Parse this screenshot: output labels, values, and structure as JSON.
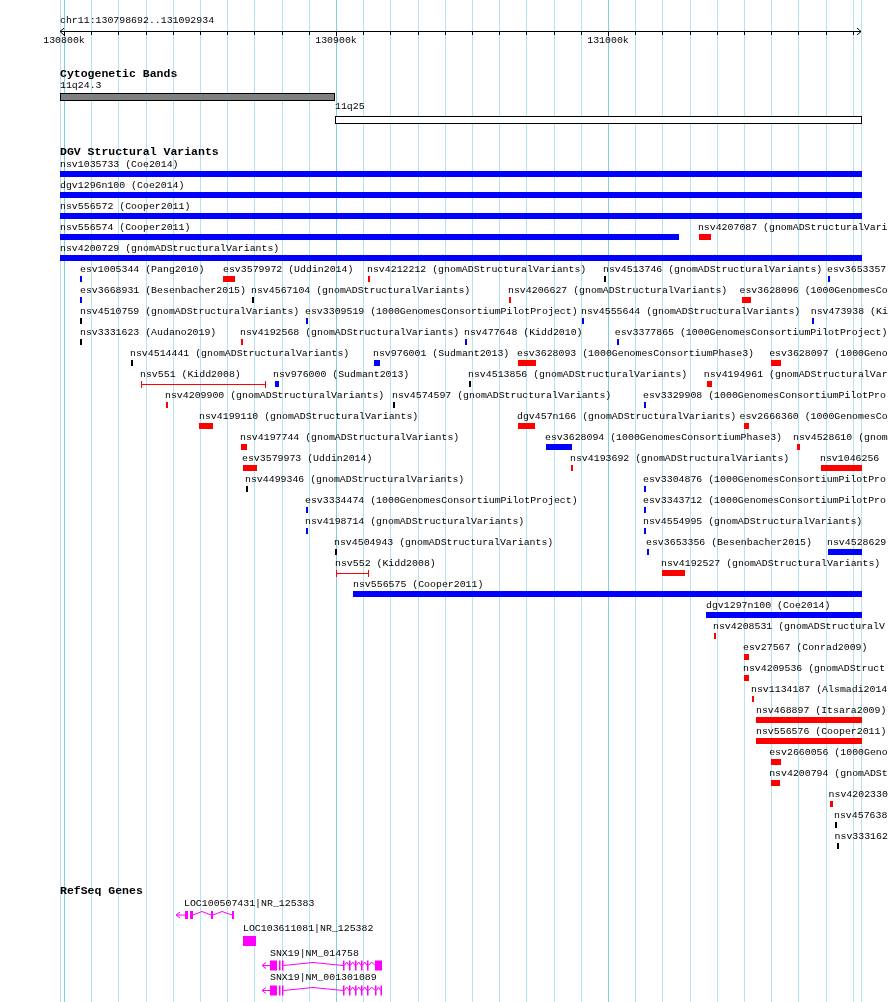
{
  "ruler": {
    "location": "chr11:130798692..131092934",
    "ticks": [
      "130800k",
      "130900k",
      "131000k"
    ]
  },
  "tracks": [
    {
      "kind": "cytobands",
      "title": "Cytogenetic Bands",
      "features": [
        {
          "label": "11q24.3",
          "color": "#808080"
        },
        {
          "label": "11q25",
          "color": "#ffffff"
        }
      ]
    },
    {
      "kind": "variants",
      "title": "DGV Structural Variants",
      "features": [
        {
          "label": "nsv1035733 (Coe2014)",
          "kind": "bar",
          "color": "#0000ff"
        },
        {
          "label": "dgv1296n100 (Coe2014)",
          "kind": "bar",
          "color": "#0000ff"
        },
        {
          "label": "nsv556572 (Cooper2011)",
          "kind": "bar",
          "color": "#0000ff"
        },
        {
          "label": "nsv556574 (Cooper2011)",
          "kind": "bar",
          "color": "#0000ff"
        },
        {
          "label": "nsv4207087 (gnomADStructuralVari",
          "kind": "bar",
          "color": "#ff0000"
        },
        {
          "label": "nsv4200729 (gnomADStructuralVariants)",
          "kind": "bar",
          "color": "#0000ff"
        },
        {
          "label": "esv1005344 (Pang2010)",
          "kind": "bar",
          "color": "#0000ff"
        },
        {
          "label": "esv3579972 (Uddin2014)",
          "kind": "bar",
          "color": "#ff0000"
        },
        {
          "label": "nsv4212212 (gnomADStructuralVariants)",
          "kind": "bar",
          "color": "#ff0000"
        },
        {
          "label": "nsv4513746 (gnomADStructuralVariants)",
          "kind": "bar",
          "color": "#000000"
        },
        {
          "label": "esv3653357",
          "kind": "bar",
          "color": "#0000ff"
        },
        {
          "label": "esv3668931 (Besenbacher2015)",
          "kind": "bar",
          "color": "#0000ff"
        },
        {
          "label": "nsv4567104 (gnomADStructuralVariants)",
          "kind": "bar",
          "color": "#000000"
        },
        {
          "label": "nsv4206627 (gnomADStructuralVariants)",
          "kind": "bar",
          "color": "#ff0000"
        },
        {
          "label": "esv3628096 (1000GenomesCo",
          "kind": "bar",
          "color": "#ff0000"
        },
        {
          "label": "nsv4510759 (gnomADStructuralVariants)",
          "kind": "bar",
          "color": "#000000"
        },
        {
          "label": "esv3309519 (1000GenomesConsortiumPilotProject)",
          "kind": "bar",
          "color": "#0000ff"
        },
        {
          "label": "nsv4555644 (gnomADStructuralVariants)",
          "kind": "bar",
          "color": "#0000ff"
        },
        {
          "label": "nsv473938 (Ki",
          "kind": "bar",
          "color": "#0000ff"
        },
        {
          "label": "nsv3331623 (Audano2019)",
          "kind": "bar",
          "color": "#000000"
        },
        {
          "label": "nsv4192568 (gnomADStructuralVariants)",
          "kind": "bar",
          "color": "#ff0000"
        },
        {
          "label": "nsv477648 (Kidd2010)",
          "kind": "bar",
          "color": "#0000ff"
        },
        {
          "label": "esv3377865 (1000GenomesConsortiumPilotProject)",
          "kind": "bar",
          "color": "#0000ff"
        },
        {
          "label": "nsv4514441 (gnomADStructuralVariants)",
          "kind": "bar",
          "color": "#000000"
        },
        {
          "label": "nsv976001 (Sudmant2013)",
          "kind": "bar",
          "color": "#0000ff"
        },
        {
          "label": "esv3628093 (1000GenomesConsortiumPhase3)",
          "kind": "bar",
          "color": "#ff0000"
        },
        {
          "label": "esv3628097 (1000Geno",
          "kind": "bar",
          "color": "#ff0000"
        },
        {
          "label": "nsv551 (Kidd2008)",
          "kind": "span",
          "color": "#ff0000"
        },
        {
          "label": "nsv976000 (Sudmant2013)",
          "kind": "bar",
          "color": "#0000ff"
        },
        {
          "label": "nsv4513856 (gnomADStructuralVariants)",
          "kind": "bar",
          "color": "#000000"
        },
        {
          "label": "nsv4194961 (gnomADStructuralVar",
          "kind": "bar",
          "color": "#ff0000"
        },
        {
          "label": "nsv4209900 (gnomADStructuralVariants)",
          "kind": "bar",
          "color": "#ff0000"
        },
        {
          "label": "nsv4574597 (gnomADStructuralVariants)",
          "kind": "bar",
          "color": "#000000"
        },
        {
          "label": "esv3329908 (1000GenomesConsortiumPilotPro",
          "kind": "bar",
          "color": "#0000ff"
        },
        {
          "label": "nsv4199110 (gnomADStructuralVariants)",
          "kind": "bar",
          "color": "#ff0000"
        },
        {
          "label": "dgv457n166 (gnomADStructuralVariants)",
          "kind": "bar",
          "color": "#ff0000"
        },
        {
          "label": "esv2666360 (1000GenomesCo",
          "kind": "bar",
          "color": "#ff0000"
        },
        {
          "label": "nsv4197744 (gnomADStructuralVariants)",
          "kind": "bar",
          "color": "#ff0000"
        },
        {
          "label": "esv3628094 (1000GenomesConsortiumPhase3)",
          "kind": "bar",
          "color": "#0000ff"
        },
        {
          "label": "nsv4528610 (gnom",
          "kind": "bar",
          "color": "#ff0000"
        },
        {
          "label": "esv3579973 (Uddin2014)",
          "kind": "bar",
          "color": "#ff0000"
        },
        {
          "label": "nsv4193692 (gnomADStructuralVariants)",
          "kind": "bar",
          "color": "#ff0000"
        },
        {
          "label": "nsv1046256",
          "kind": "bar",
          "color": "#ff0000"
        },
        {
          "label": "nsv4499346 (gnomADStructuralVariants)",
          "kind": "bar",
          "color": "#000000"
        },
        {
          "label": "esv3304876 (1000GenomesConsortiumPilotPro",
          "kind": "bar",
          "color": "#0000ff"
        },
        {
          "label": "esv3334474 (1000GenomesConsortiumPilotProject)",
          "kind": "bar",
          "color": "#0000ff"
        },
        {
          "label": "esv3343712 (1000GenomesConsortiumPilotPro",
          "kind": "bar",
          "color": "#0000ff"
        },
        {
          "label": "nsv4198714 (gnomADStructuralVariants)",
          "kind": "bar",
          "color": "#0000ff"
        },
        {
          "label": "nsv4554995 (gnomADStructuralVariants)",
          "kind": "bar",
          "color": "#0000ff"
        },
        {
          "label": "nsv4504943 (gnomADStructuralVariants)",
          "kind": "bar",
          "color": "#000000"
        },
        {
          "label": "esv3653356 (Besenbacher2015)",
          "kind": "bar",
          "color": "#0000ff"
        },
        {
          "label": "nsv4528629",
          "kind": "bar",
          "color": "#0000ff"
        },
        {
          "label": "nsv552 (Kidd2008)",
          "kind": "span",
          "color": "#ff0000"
        },
        {
          "label": "nsv4192527 (gnomADStructuralVariants)",
          "kind": "bar",
          "color": "#ff0000"
        },
        {
          "label": "nsv556575 (Cooper2011)",
          "kind": "bar",
          "color": "#0000ff"
        },
        {
          "label": "dgv1297n100 (Coe2014)",
          "kind": "bar",
          "color": "#0000ff"
        },
        {
          "label": "nsv4208531 (gnomADStructuralV",
          "kind": "bar",
          "color": "#ff0000"
        },
        {
          "label": "esv27567 (Conrad2009)",
          "kind": "bar",
          "color": "#ff0000"
        },
        {
          "label": "nsv4209536 (gnomADStruct",
          "kind": "bar",
          "color": "#ff0000"
        },
        {
          "label": "nsv1134187 (Alsmadi2014",
          "kind": "bar",
          "color": "#ff0000"
        },
        {
          "label": "nsv468897 (Itsara2009)",
          "kind": "bar",
          "color": "#ff0000"
        },
        {
          "label": "nsv556576 (Cooper2011)",
          "kind": "bar",
          "color": "#ff0000"
        },
        {
          "label": "esv2660056 (1000Geno",
          "kind": "bar",
          "color": "#ff0000"
        },
        {
          "label": "nsv4200794 (gnomADSt",
          "kind": "bar",
          "color": "#ff0000"
        },
        {
          "label": "nsv4202330",
          "kind": "bar",
          "color": "#ff0000"
        },
        {
          "label": "nsv457638",
          "kind": "bar",
          "color": "#000000"
        },
        {
          "label": "nsv333162",
          "kind": "bar",
          "color": "#000000"
        }
      ]
    },
    {
      "kind": "genes",
      "title": "RefSeq Genes",
      "features": [
        {
          "label": "LOC100507431|NR_125383"
        },
        {
          "label": "LOC103611081|NR_125382"
        },
        {
          "label": "SNX19|NM_014758"
        },
        {
          "label": "SNX19|NM_001301089"
        }
      ]
    }
  ]
}
